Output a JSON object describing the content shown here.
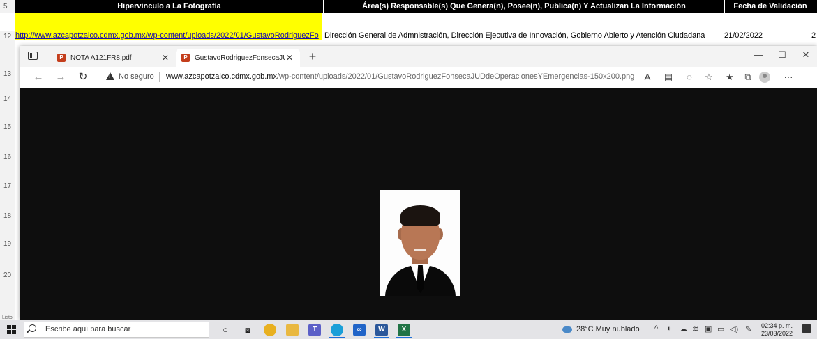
{
  "sheet": {
    "rows": [
      "5",
      "12",
      "13",
      "14",
      "15",
      "16",
      "17",
      "18",
      "19",
      "20"
    ],
    "status_text": "Listo",
    "headers": {
      "foto": "Hipervínculo a La Fotografía",
      "area": "Área(s) Responsable(s) Que Genera(n), Posee(n), Publica(n) Y Actualizan La Información",
      "fecha": "Fecha de Validación"
    },
    "row12": {
      "link": "http://www.azcapotzalco.cdmx.gob.mx/wp-content/uploads/2022/01/GustavoRodriguezFo",
      "area": "Dirección General de Admnistración, Dirección Ejecutiva de Innovación, Gobierno Abierto y Atención Ciudadana",
      "fecha": "21/02/2022",
      "extra": "2"
    }
  },
  "browser": {
    "tabs": [
      {
        "title": "NOTA A121FR8.pdf",
        "icon": "pdf-icon"
      },
      {
        "title": "GustavoRodriguezFonsecaJUDde",
        "icon": "pdf-icon"
      }
    ],
    "address": {
      "security_label": "No seguro",
      "url_host": "www.azcapotzalco.cdmx.gob.mx",
      "url_path": "/wp-content/uploads/2022/01/GustavoRodriguezFonsecaJUDdeOperacionesYEmergencias-150x200.png"
    }
  },
  "taskbar": {
    "search_placeholder": "Escribe aquí para buscar",
    "weather": "28°C  Muy nublado",
    "time": "02:34 p. m.",
    "date": "23/03/2022",
    "apps": [
      "cortana-icon",
      "task-view-icon",
      "chrome-icon",
      "file-explorer-icon",
      "teams-icon",
      "edge-icon",
      "app-icon",
      "word-icon",
      "excel-icon"
    ]
  },
  "colors": {
    "header_bg": "#000000",
    "highlight": "#ffff00",
    "viewport_bg": "#0e0e0e",
    "taskbar_bg": "#e4e4e7",
    "accent": "#1e6fd9"
  }
}
